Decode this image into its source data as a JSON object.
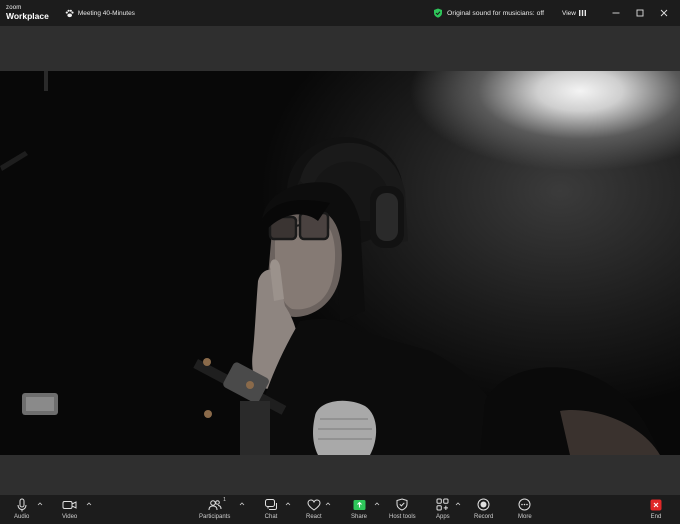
{
  "titlebar": {
    "brand_small": "zoom",
    "brand_big": "Workplace",
    "meeting_title": "Meeting 40-Minutes",
    "sound_status": "Original sound for musicians: off",
    "view_label": "View"
  },
  "toolbar": {
    "audio": "Audio",
    "video": "Video",
    "participants": "Participants",
    "participants_count": "1",
    "chat": "Chat",
    "react": "React",
    "share": "Share",
    "host_tools": "Host tools",
    "apps": "Apps",
    "record": "Record",
    "more": "More",
    "end": "End"
  },
  "colors": {
    "share_green": "#2ec65a",
    "shield_green": "#2ec65a",
    "end_red": "#e02828",
    "bar": "#1c1c1c",
    "stage": "#2f2f2f"
  }
}
